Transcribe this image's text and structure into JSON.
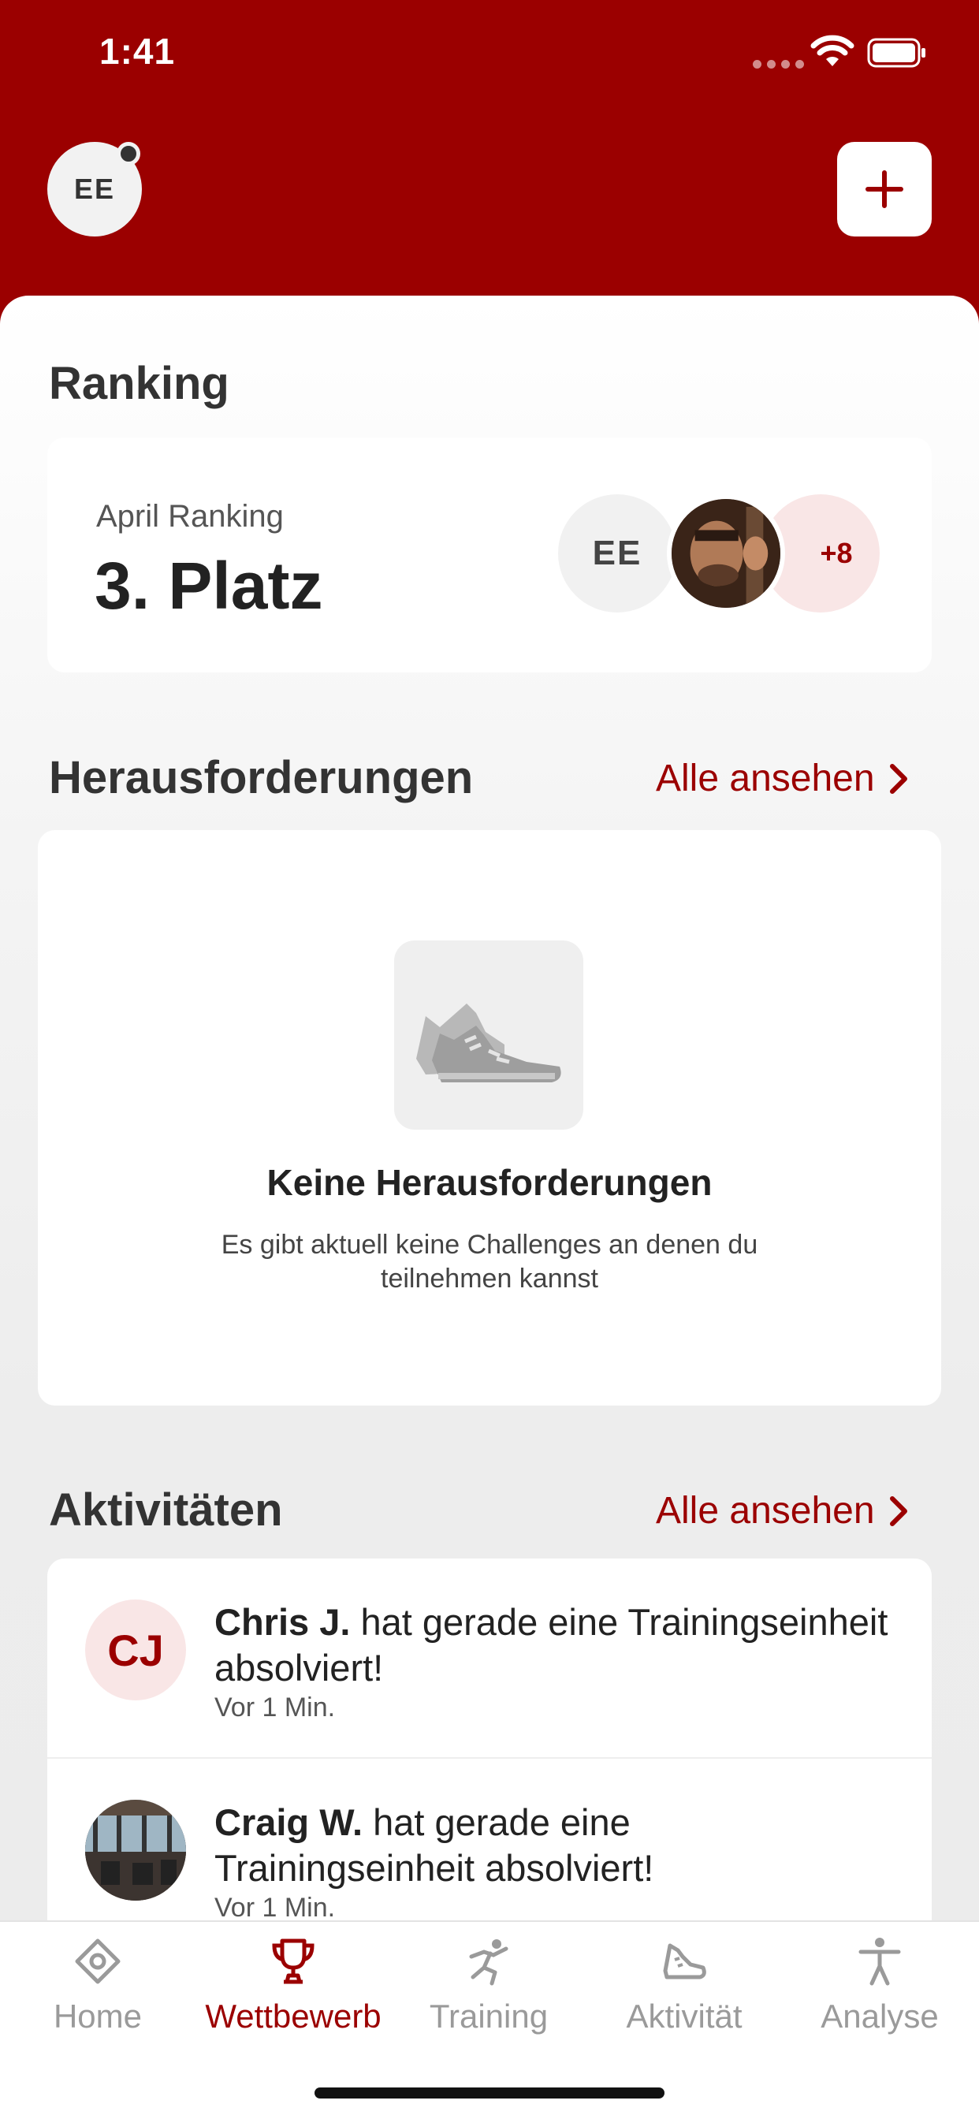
{
  "status_bar": {
    "time": "1:41"
  },
  "header": {
    "user_initials": "EE"
  },
  "ranking": {
    "section_title": "Ranking",
    "subtitle": "April Ranking",
    "place": "3. Platz",
    "avatar_initials": "EE",
    "more_count": "+8"
  },
  "challenges": {
    "section_title": "Herausforderungen",
    "see_all": "Alle ansehen",
    "empty_title": "Keine Herausforderungen",
    "empty_description": "Es gibt aktuell keine Challenges an denen du teilnehmen kannst"
  },
  "activities": {
    "section_title": "Aktivitäten",
    "see_all": "Alle ansehen",
    "items": [
      {
        "initials": "CJ",
        "name": "Chris J.",
        "message": " hat gerade eine Trainingseinheit absolviert!",
        "time": "Vor 1 Min."
      },
      {
        "initials": "",
        "name": "Craig W.",
        "message": " hat gerade eine Trainingseinheit absolviert!",
        "time": "Vor 1 Min."
      }
    ]
  },
  "tabbar": {
    "active": "Wettbewerb",
    "tabs": [
      {
        "label": "Home",
        "icon": "home-icon"
      },
      {
        "label": "Wettbewerb",
        "icon": "trophy-icon"
      },
      {
        "label": "Training",
        "icon": "running-figure-icon"
      },
      {
        "label": "Aktivität",
        "icon": "sneaker-icon"
      },
      {
        "label": "Analyse",
        "icon": "person-icon"
      }
    ]
  },
  "colors": {
    "brand": "#9b0000",
    "inactive_tab": "#9a9a9a"
  }
}
